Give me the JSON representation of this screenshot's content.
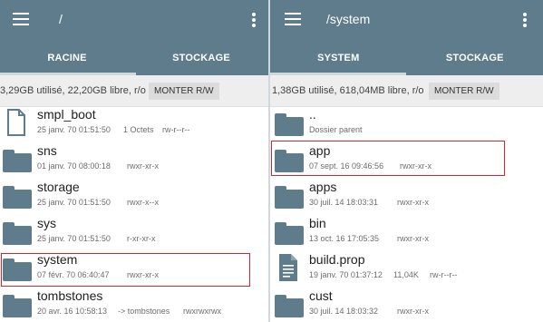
{
  "left": {
    "path": "/",
    "tabs": [
      "RACINE",
      "STOCKAGE"
    ],
    "active_tab": "RACINE",
    "storage_info": "3,29GB utilisé, 22,20GB libre, r/o",
    "mount_label": "MONTER R/W",
    "entries": [
      {
        "name": "smpl_boot",
        "date": "25 janv. 70 01:51:50",
        "extra": "1 Octets",
        "perms": "rw-r--r--",
        "icon": "file-outline-icon"
      },
      {
        "name": "sns",
        "date": "01 janv. 70 08:00:18",
        "extra": "",
        "perms": "rwxr-xr-x",
        "icon": "folder-icon"
      },
      {
        "name": "storage",
        "date": "25 janv. 70 01:51:50",
        "extra": "",
        "perms": "rwxr-x--x",
        "icon": "folder-icon"
      },
      {
        "name": "sys",
        "date": "25 janv. 70 01:51:50",
        "extra": "",
        "perms": "r-xr-xr-x",
        "icon": "folder-icon"
      },
      {
        "name": "system",
        "date": "07 févr. 70 06:40:47",
        "extra": "",
        "perms": "rwxr-xr-x",
        "icon": "folder-icon",
        "highlighted": true
      },
      {
        "name": "tombstones",
        "date": "20 avr. 16 10:58:13",
        "extra": "-> tombstones",
        "perms": "rwxrwxrwx",
        "icon": "folder-icon"
      }
    ]
  },
  "right": {
    "path": "/system",
    "tabs": [
      "SYSTEM",
      "STOCKAGE"
    ],
    "active_tab": "SYSTEM",
    "storage_info": "1,38GB utilisé, 618,04MB libre, r/o",
    "mount_label": "MONTER R/W",
    "entries": [
      {
        "name": "..",
        "date": "Dossier parent",
        "extra": "",
        "perms": "",
        "icon": "folder-icon"
      },
      {
        "name": "app",
        "date": "07 sept. 16 09:46:56",
        "extra": "",
        "perms": "rwxr-xr-x",
        "icon": "folder-icon",
        "highlighted": true
      },
      {
        "name": "apps",
        "date": "30 juil. 14 18:03:31",
        "extra": "",
        "perms": "rwxr-xr-x",
        "icon": "folder-icon"
      },
      {
        "name": "bin",
        "date": "13 oct. 16 17:05:35",
        "extra": "",
        "perms": "rwxr-xr-x",
        "icon": "folder-icon"
      },
      {
        "name": "build.prop",
        "date": "19 janv. 70 01:37:12",
        "extra": "11,04K",
        "perms": "rw-r--r--",
        "icon": "text-file-icon"
      },
      {
        "name": "cust",
        "date": "30 juil. 14 18:03:32",
        "extra": "",
        "perms": "rwxr-xr-x",
        "icon": "folder-icon"
      }
    ]
  },
  "colors": {
    "toolbar": "#5e7c8b",
    "highlight_border": "#d9232e",
    "status_bg": "#eeeeee"
  }
}
